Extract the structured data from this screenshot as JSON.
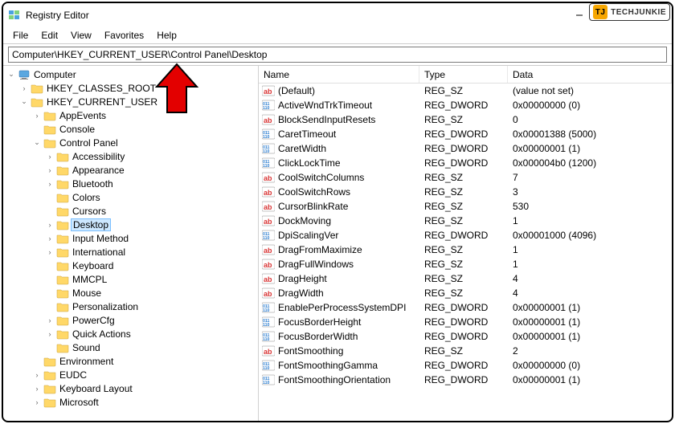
{
  "window": {
    "title": "Registry Editor"
  },
  "watermark": {
    "badge": "TJ",
    "text": "TECHJUNKIE"
  },
  "menu": {
    "file": "File",
    "edit": "Edit",
    "view": "View",
    "favorites": "Favorites",
    "help": "Help"
  },
  "address": {
    "path": "Computer\\HKEY_CURRENT_USER\\Control Panel\\Desktop"
  },
  "tree": {
    "root": "Computer",
    "hkcr": "HKEY_CLASSES_ROOT",
    "hkcu": "HKEY_CURRENT_USER",
    "items": {
      "appEvents": "AppEvents",
      "console": "Console",
      "controlPanel": "Control Panel",
      "accessibility": "Accessibility",
      "appearance": "Appearance",
      "bluetooth": "Bluetooth",
      "colors": "Colors",
      "cursors": "Cursors",
      "desktop": "Desktop",
      "inputMethod": "Input Method",
      "international": "International",
      "keyboard": "Keyboard",
      "mmcpl": "MMCPL",
      "mouse": "Mouse",
      "personalization": "Personalization",
      "powerCfg": "PowerCfg",
      "quickActions": "Quick Actions",
      "sound": "Sound",
      "environment": "Environment",
      "eudc": "EUDC",
      "keyboardLayout": "Keyboard Layout",
      "microsoft": "Microsoft"
    }
  },
  "columns": {
    "name": "Name",
    "type": "Type",
    "data": "Data"
  },
  "values": [
    {
      "icon": "sz",
      "name": "(Default)",
      "type": "REG_SZ",
      "data": "(value not set)"
    },
    {
      "icon": "bin",
      "name": "ActiveWndTrkTimeout",
      "type": "REG_DWORD",
      "data": "0x00000000 (0)"
    },
    {
      "icon": "sz",
      "name": "BlockSendInputResets",
      "type": "REG_SZ",
      "data": "0"
    },
    {
      "icon": "bin",
      "name": "CaretTimeout",
      "type": "REG_DWORD",
      "data": "0x00001388 (5000)"
    },
    {
      "icon": "bin",
      "name": "CaretWidth",
      "type": "REG_DWORD",
      "data": "0x00000001 (1)"
    },
    {
      "icon": "bin",
      "name": "ClickLockTime",
      "type": "REG_DWORD",
      "data": "0x000004b0 (1200)"
    },
    {
      "icon": "sz",
      "name": "CoolSwitchColumns",
      "type": "REG_SZ",
      "data": "7"
    },
    {
      "icon": "sz",
      "name": "CoolSwitchRows",
      "type": "REG_SZ",
      "data": "3"
    },
    {
      "icon": "sz",
      "name": "CursorBlinkRate",
      "type": "REG_SZ",
      "data": "530"
    },
    {
      "icon": "sz",
      "name": "DockMoving",
      "type": "REG_SZ",
      "data": "1"
    },
    {
      "icon": "bin",
      "name": "DpiScalingVer",
      "type": "REG_DWORD",
      "data": "0x00001000 (4096)"
    },
    {
      "icon": "sz",
      "name": "DragFromMaximize",
      "type": "REG_SZ",
      "data": "1"
    },
    {
      "icon": "sz",
      "name": "DragFullWindows",
      "type": "REG_SZ",
      "data": "1"
    },
    {
      "icon": "sz",
      "name": "DragHeight",
      "type": "REG_SZ",
      "data": "4"
    },
    {
      "icon": "sz",
      "name": "DragWidth",
      "type": "REG_SZ",
      "data": "4"
    },
    {
      "icon": "bin",
      "name": "EnablePerProcessSystemDPI",
      "type": "REG_DWORD",
      "data": "0x00000001 (1)"
    },
    {
      "icon": "bin",
      "name": "FocusBorderHeight",
      "type": "REG_DWORD",
      "data": "0x00000001 (1)"
    },
    {
      "icon": "bin",
      "name": "FocusBorderWidth",
      "type": "REG_DWORD",
      "data": "0x00000001 (1)"
    },
    {
      "icon": "sz",
      "name": "FontSmoothing",
      "type": "REG_SZ",
      "data": "2"
    },
    {
      "icon": "bin",
      "name": "FontSmoothingGamma",
      "type": "REG_DWORD",
      "data": "0x00000000 (0)"
    },
    {
      "icon": "bin",
      "name": "FontSmoothingOrientation",
      "type": "REG_DWORD",
      "data": "0x00000001 (1)"
    }
  ]
}
